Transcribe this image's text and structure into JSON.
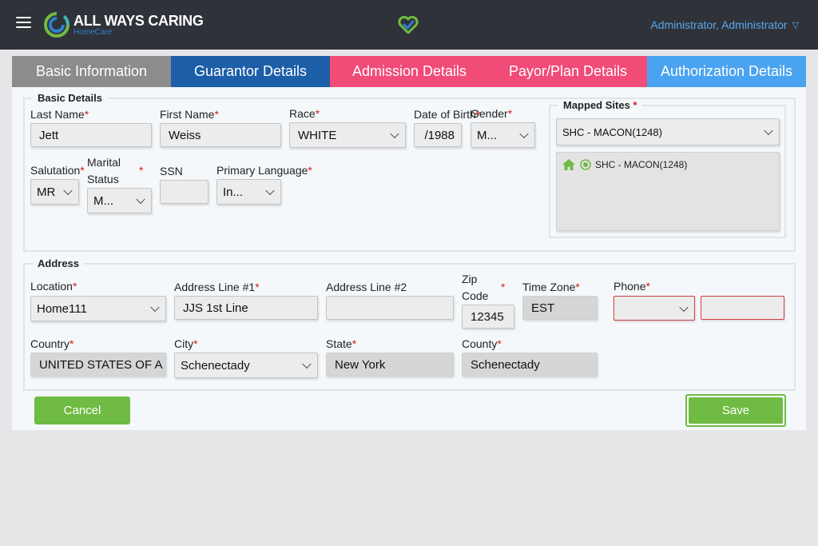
{
  "header": {
    "brand_name": "ALL WAYS CARING",
    "brand_sub": "HomeCare",
    "user_label": "Administrator, Administrator"
  },
  "tabs": [
    {
      "label": "Basic Information"
    },
    {
      "label": "Guarantor Details"
    },
    {
      "label": "Admission Details"
    },
    {
      "label": "Payor/Plan Details"
    },
    {
      "label": "Authorization Details"
    }
  ],
  "basic": {
    "legend": "Basic Details",
    "last_name_label": "Last Name",
    "last_name": "Jett",
    "first_name_label": "First Name",
    "first_name": "Weiss",
    "race_label": "Race",
    "race": "WHITE",
    "dob_label": "Date of Birth",
    "dob": "/1988",
    "gender_label": "Gender",
    "gender": "M...",
    "salutation_label": "Salutation",
    "salutation": "MR",
    "marital_label_1": "Marital",
    "marital_label_2": "Status",
    "marital": "M...",
    "ssn_label": "SSN",
    "ssn": "",
    "language_label": "Primary Language",
    "language": "In...",
    "required_mark": "*"
  },
  "mapped": {
    "label": "Mapped Sites",
    "selected": "SHC - MACON(1248)",
    "items": [
      {
        "label": "SHC - MACON(1248)"
      }
    ]
  },
  "address": {
    "legend": "Address",
    "location_label": "Location",
    "location": "Home111",
    "line1_label": "Address Line #1",
    "line1": "JJS 1st Line",
    "line2_label": "Address Line #2",
    "line2": "",
    "zip_label_1": "Zip",
    "zip_label_2": "Code",
    "zip": "12345",
    "tz_label": "Time Zone",
    "tz": "EST",
    "phone_label": "Phone",
    "phone_type": "",
    "phone_number": "",
    "country_label": "Country",
    "country": "UNITED STATES OF A",
    "city_label": "City",
    "city": "Schenectady",
    "state_label": "State",
    "state": "New York",
    "county_label": "County",
    "county": "Schenectady"
  },
  "actions": {
    "cancel": "Cancel",
    "save": "Save"
  },
  "colors": {
    "topbar": "#2f3238",
    "tab_basic": "#8c8c8c",
    "tab_guarantor": "#1d5ea8",
    "tab_admission": "#f14b78",
    "tab_payor": "#f14b78",
    "tab_auth": "#4aa3f0",
    "button_green": "#6fbb43",
    "required_red": "#d42020"
  }
}
